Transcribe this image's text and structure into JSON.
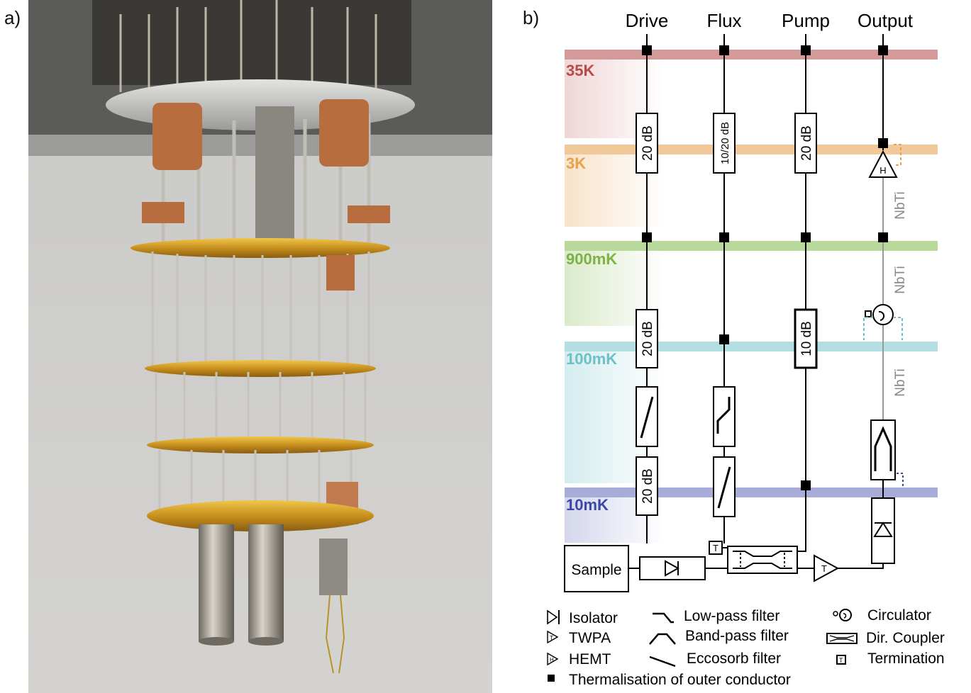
{
  "panels": {
    "a": "a)",
    "b": "b)"
  },
  "lines": {
    "drive": "Drive",
    "flux": "Flux",
    "pump": "Pump",
    "output": "Output"
  },
  "stages": {
    "s35k": {
      "label": "35K",
      "color": "#b84a4a"
    },
    "s3k": {
      "label": "3K",
      "color": "#e8a24a"
    },
    "s900": {
      "label": "900mK",
      "color": "#7cb342"
    },
    "s100": {
      "label": "100mK",
      "color": "#6ec0c8"
    },
    "s10": {
      "label": "10mK",
      "color": "#3a48a8"
    }
  },
  "attenuators": {
    "drive_3k": "20 dB",
    "flux_3k": "10/20 dB",
    "pump_3k": "20 dB",
    "drive_100": "20 dB",
    "pump_100": "10 dB",
    "drive_10": "20 dB"
  },
  "cable": {
    "nbti1": "NbTi",
    "nbti2": "NbTi",
    "nbti3": "NbTi"
  },
  "components": {
    "sample": "Sample",
    "hemt_letter": "H",
    "twpa_letter": "T",
    "term_letter": "T"
  },
  "legend": {
    "isolator": "Isolator",
    "twpa": "TWPA",
    "hemt": "HEMT",
    "lowpass": "Low-pass filter",
    "bandpass": "Band-pass filter",
    "eccosorb": "Eccosorb filter",
    "circulator": "Circulator",
    "coupler": "Dir. Coupler",
    "termination": "Termination",
    "thermal": "Thermalisation of outer conductor"
  }
}
